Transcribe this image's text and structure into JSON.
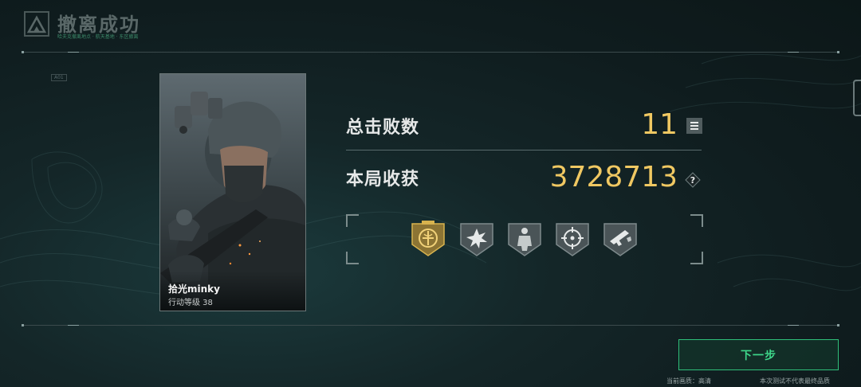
{
  "header": {
    "title": "撤离成功",
    "subtitle": "哈夫克撤离地点 · 航天基地 · 东区撤离"
  },
  "side_tag": "A01",
  "player": {
    "name": "拾光minky",
    "level_text": "行动等级 38"
  },
  "stats": {
    "kills_label": "总击败数",
    "kills_value": "11",
    "loot_label": "本局收获",
    "loot_value": "3728713"
  },
  "icons": {
    "list": "list-icon",
    "help": "question-icon",
    "help_char": "?"
  },
  "badges": [
    {
      "name": "gold-emblem-badge",
      "highlight": true
    },
    {
      "name": "explosion-badge",
      "highlight": false
    },
    {
      "name": "soldier-badge",
      "highlight": false
    },
    {
      "name": "crosshair-badge",
      "highlight": false
    },
    {
      "name": "weapon-badge",
      "highlight": false
    }
  ],
  "footer": {
    "next_label": "下一步",
    "quality_note": "当前画质：高清",
    "disclaimer": "本次测试不代表最终品质"
  },
  "colors": {
    "accent_gold": "#f0c862",
    "accent_green": "#3ed68a"
  }
}
